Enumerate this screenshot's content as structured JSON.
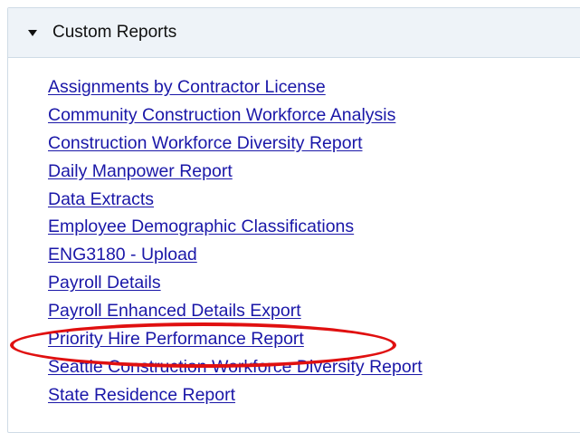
{
  "panel": {
    "title": "Custom Reports",
    "expanded": true
  },
  "reports": [
    {
      "label": "Assignments by Contractor License"
    },
    {
      "label": "Community Construction Workforce Analysis"
    },
    {
      "label": "Construction Workforce Diversity Report"
    },
    {
      "label": "Daily Manpower Report"
    },
    {
      "label": "Data Extracts"
    },
    {
      "label": "Employee Demographic Classifications"
    },
    {
      "label": "ENG3180 - Upload"
    },
    {
      "label": "Payroll Details"
    },
    {
      "label": "Payroll Enhanced Details Export"
    },
    {
      "label": "Priority Hire Performance Report",
      "highlighted": true
    },
    {
      "label": "Seattle Construction Workforce Diversity Report"
    },
    {
      "label": "State Residence Report"
    }
  ],
  "colors": {
    "link": "#1a17a8",
    "header_bg": "#eef3f8",
    "border": "#cfdbe6",
    "highlight": "#e01010"
  },
  "icons": {
    "toggle": "caret-down-icon"
  }
}
